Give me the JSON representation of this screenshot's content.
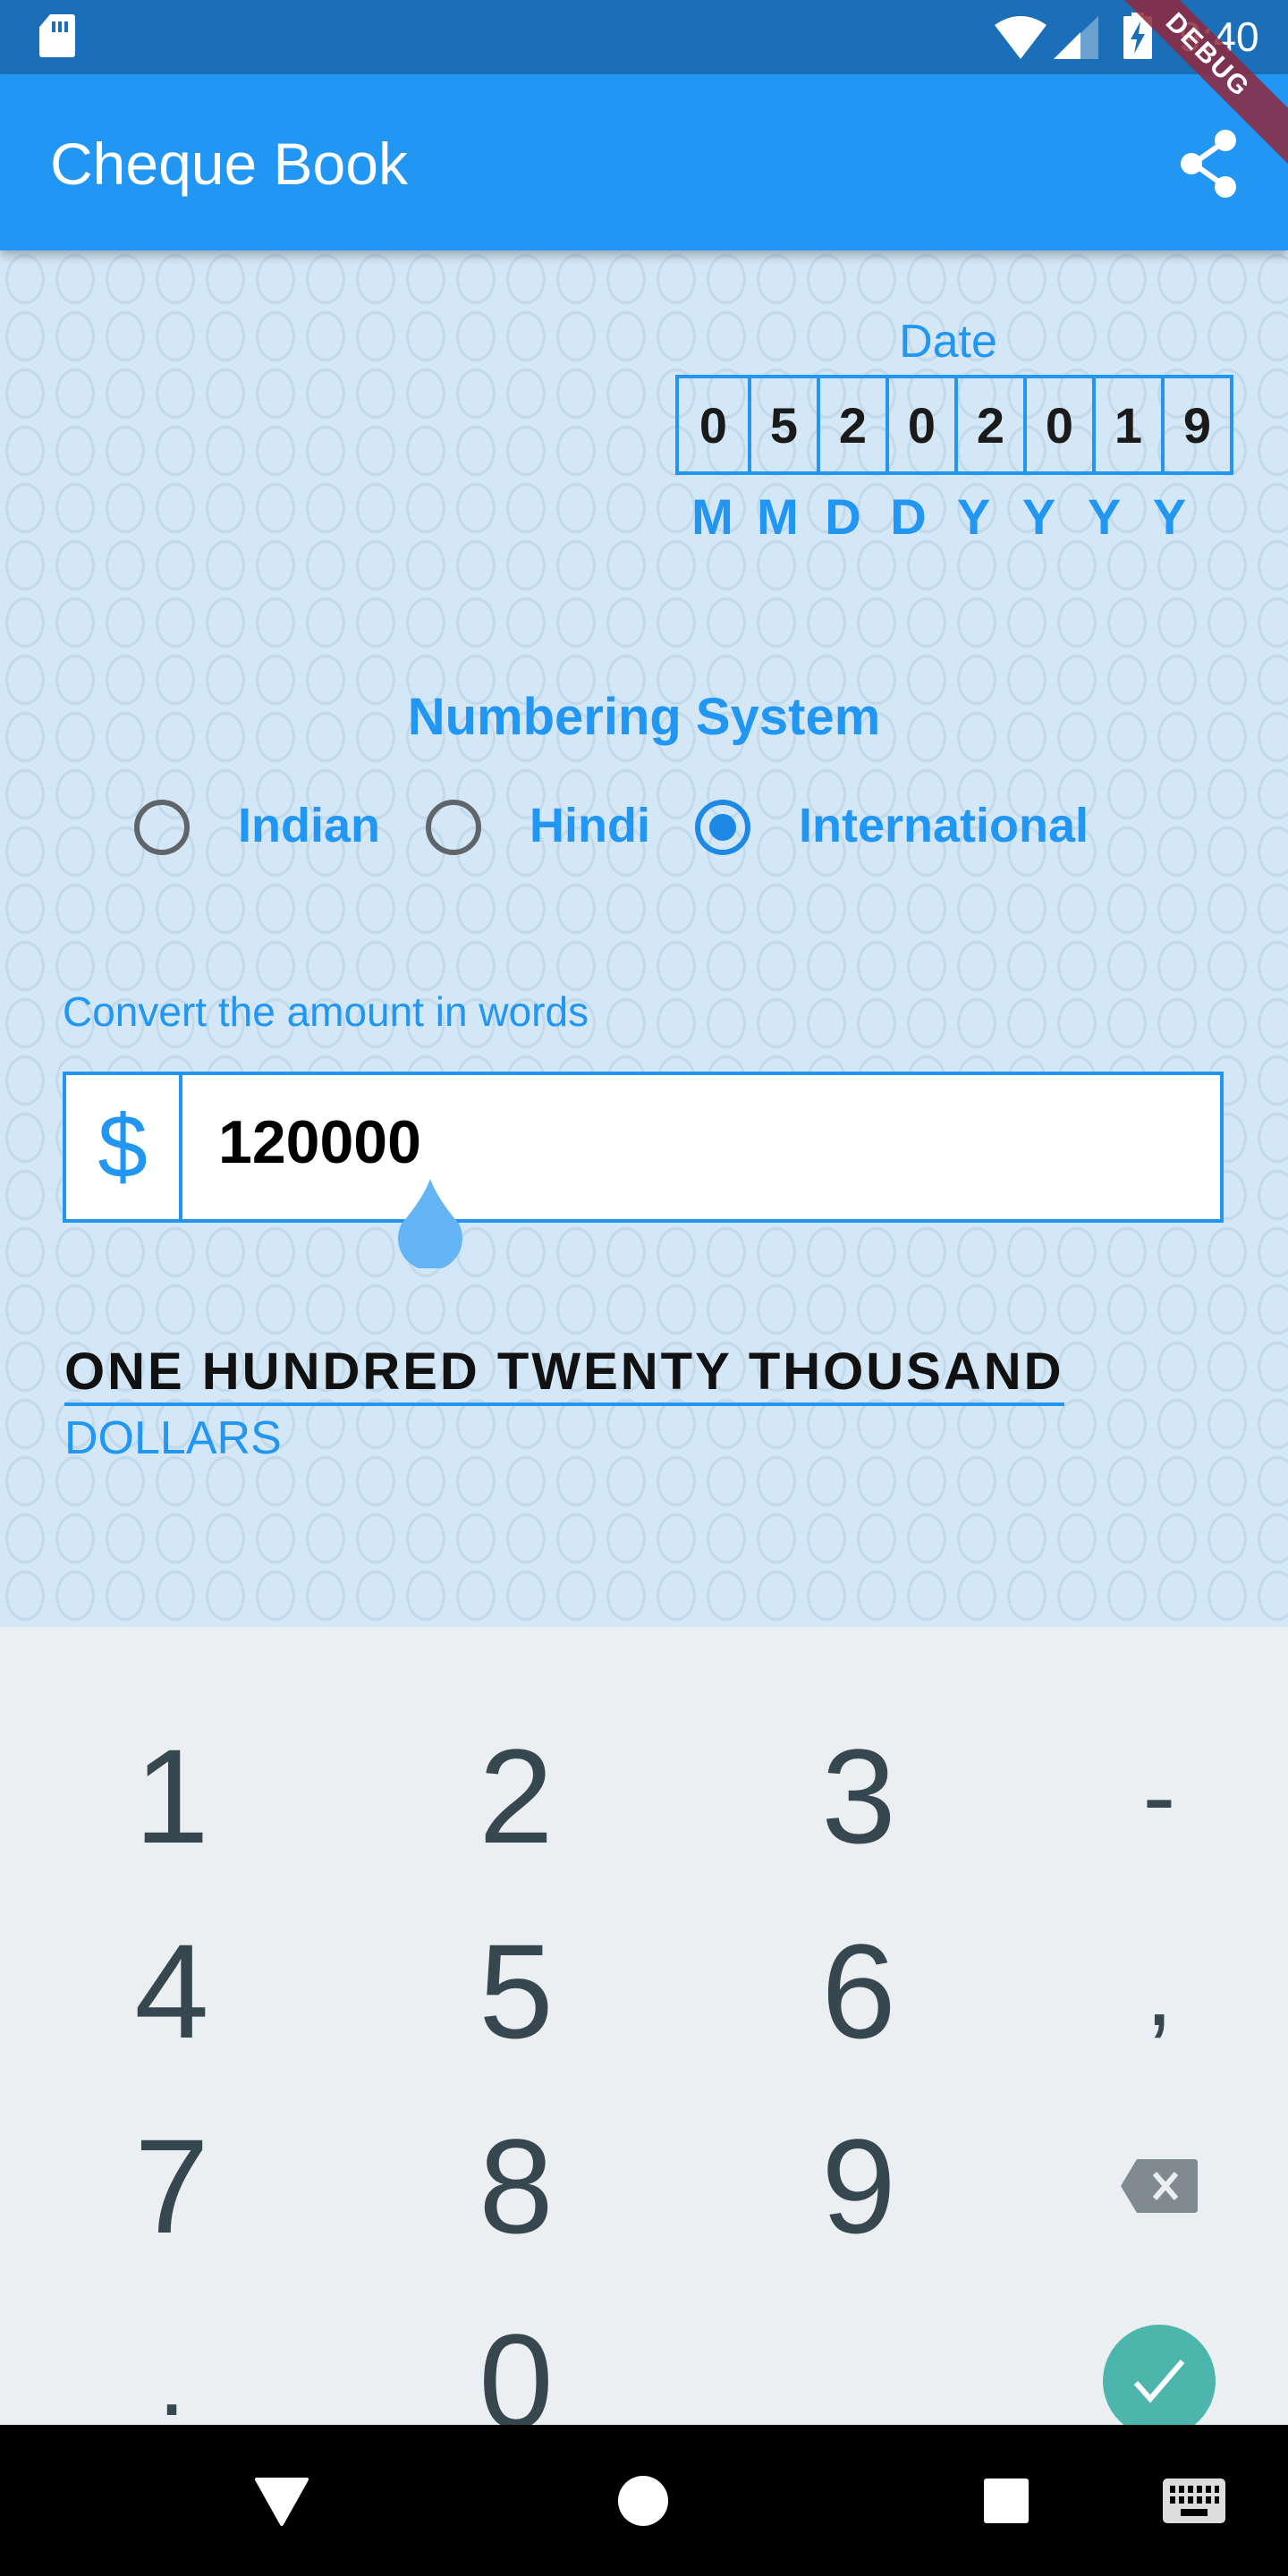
{
  "status_bar": {
    "time": "9:40",
    "icons": [
      "sd-card-icon",
      "wifi-icon",
      "signal-icon",
      "battery-charging-icon"
    ]
  },
  "debug_banner": "DEBUG",
  "app_bar": {
    "title": "Cheque Book",
    "action_icon": "share-icon"
  },
  "date": {
    "label": "Date",
    "digits": [
      "0",
      "5",
      "2",
      "0",
      "2",
      "0",
      "1",
      "9"
    ],
    "format": [
      "M",
      "M",
      "D",
      "D",
      "Y",
      "Y",
      "Y",
      "Y"
    ]
  },
  "numbering_system": {
    "title": "Numbering System",
    "options": [
      {
        "label": "Indian",
        "selected": false
      },
      {
        "label": "Hindi",
        "selected": false
      },
      {
        "label": "International",
        "selected": true
      }
    ]
  },
  "amount": {
    "label": "Convert the amount in words",
    "currency_symbol": "$",
    "value": "120000"
  },
  "result": {
    "words": "ONE HUNDRED TWENTY THOUSAND",
    "currency": "DOLLARS"
  },
  "keyboard": {
    "keys": [
      [
        "1",
        "2",
        "3",
        "-"
      ],
      [
        "4",
        "5",
        "6",
        ","
      ],
      [
        "7",
        "8",
        "9",
        "backspace"
      ],
      [
        ".",
        "0",
        "_",
        "done"
      ]
    ]
  },
  "colors": {
    "primary": "#2196f3",
    "status_bar": "#1b6fb8",
    "background": "#d3e7f6",
    "keyboard_bg": "#eceff1",
    "key_text": "#37474f",
    "enter_key": "#4db6ac",
    "radio_off": "#5f6569"
  },
  "nav_bar": {
    "buttons": [
      "back-icon",
      "home-icon",
      "recents-icon",
      "keyboard-switch-icon"
    ]
  }
}
